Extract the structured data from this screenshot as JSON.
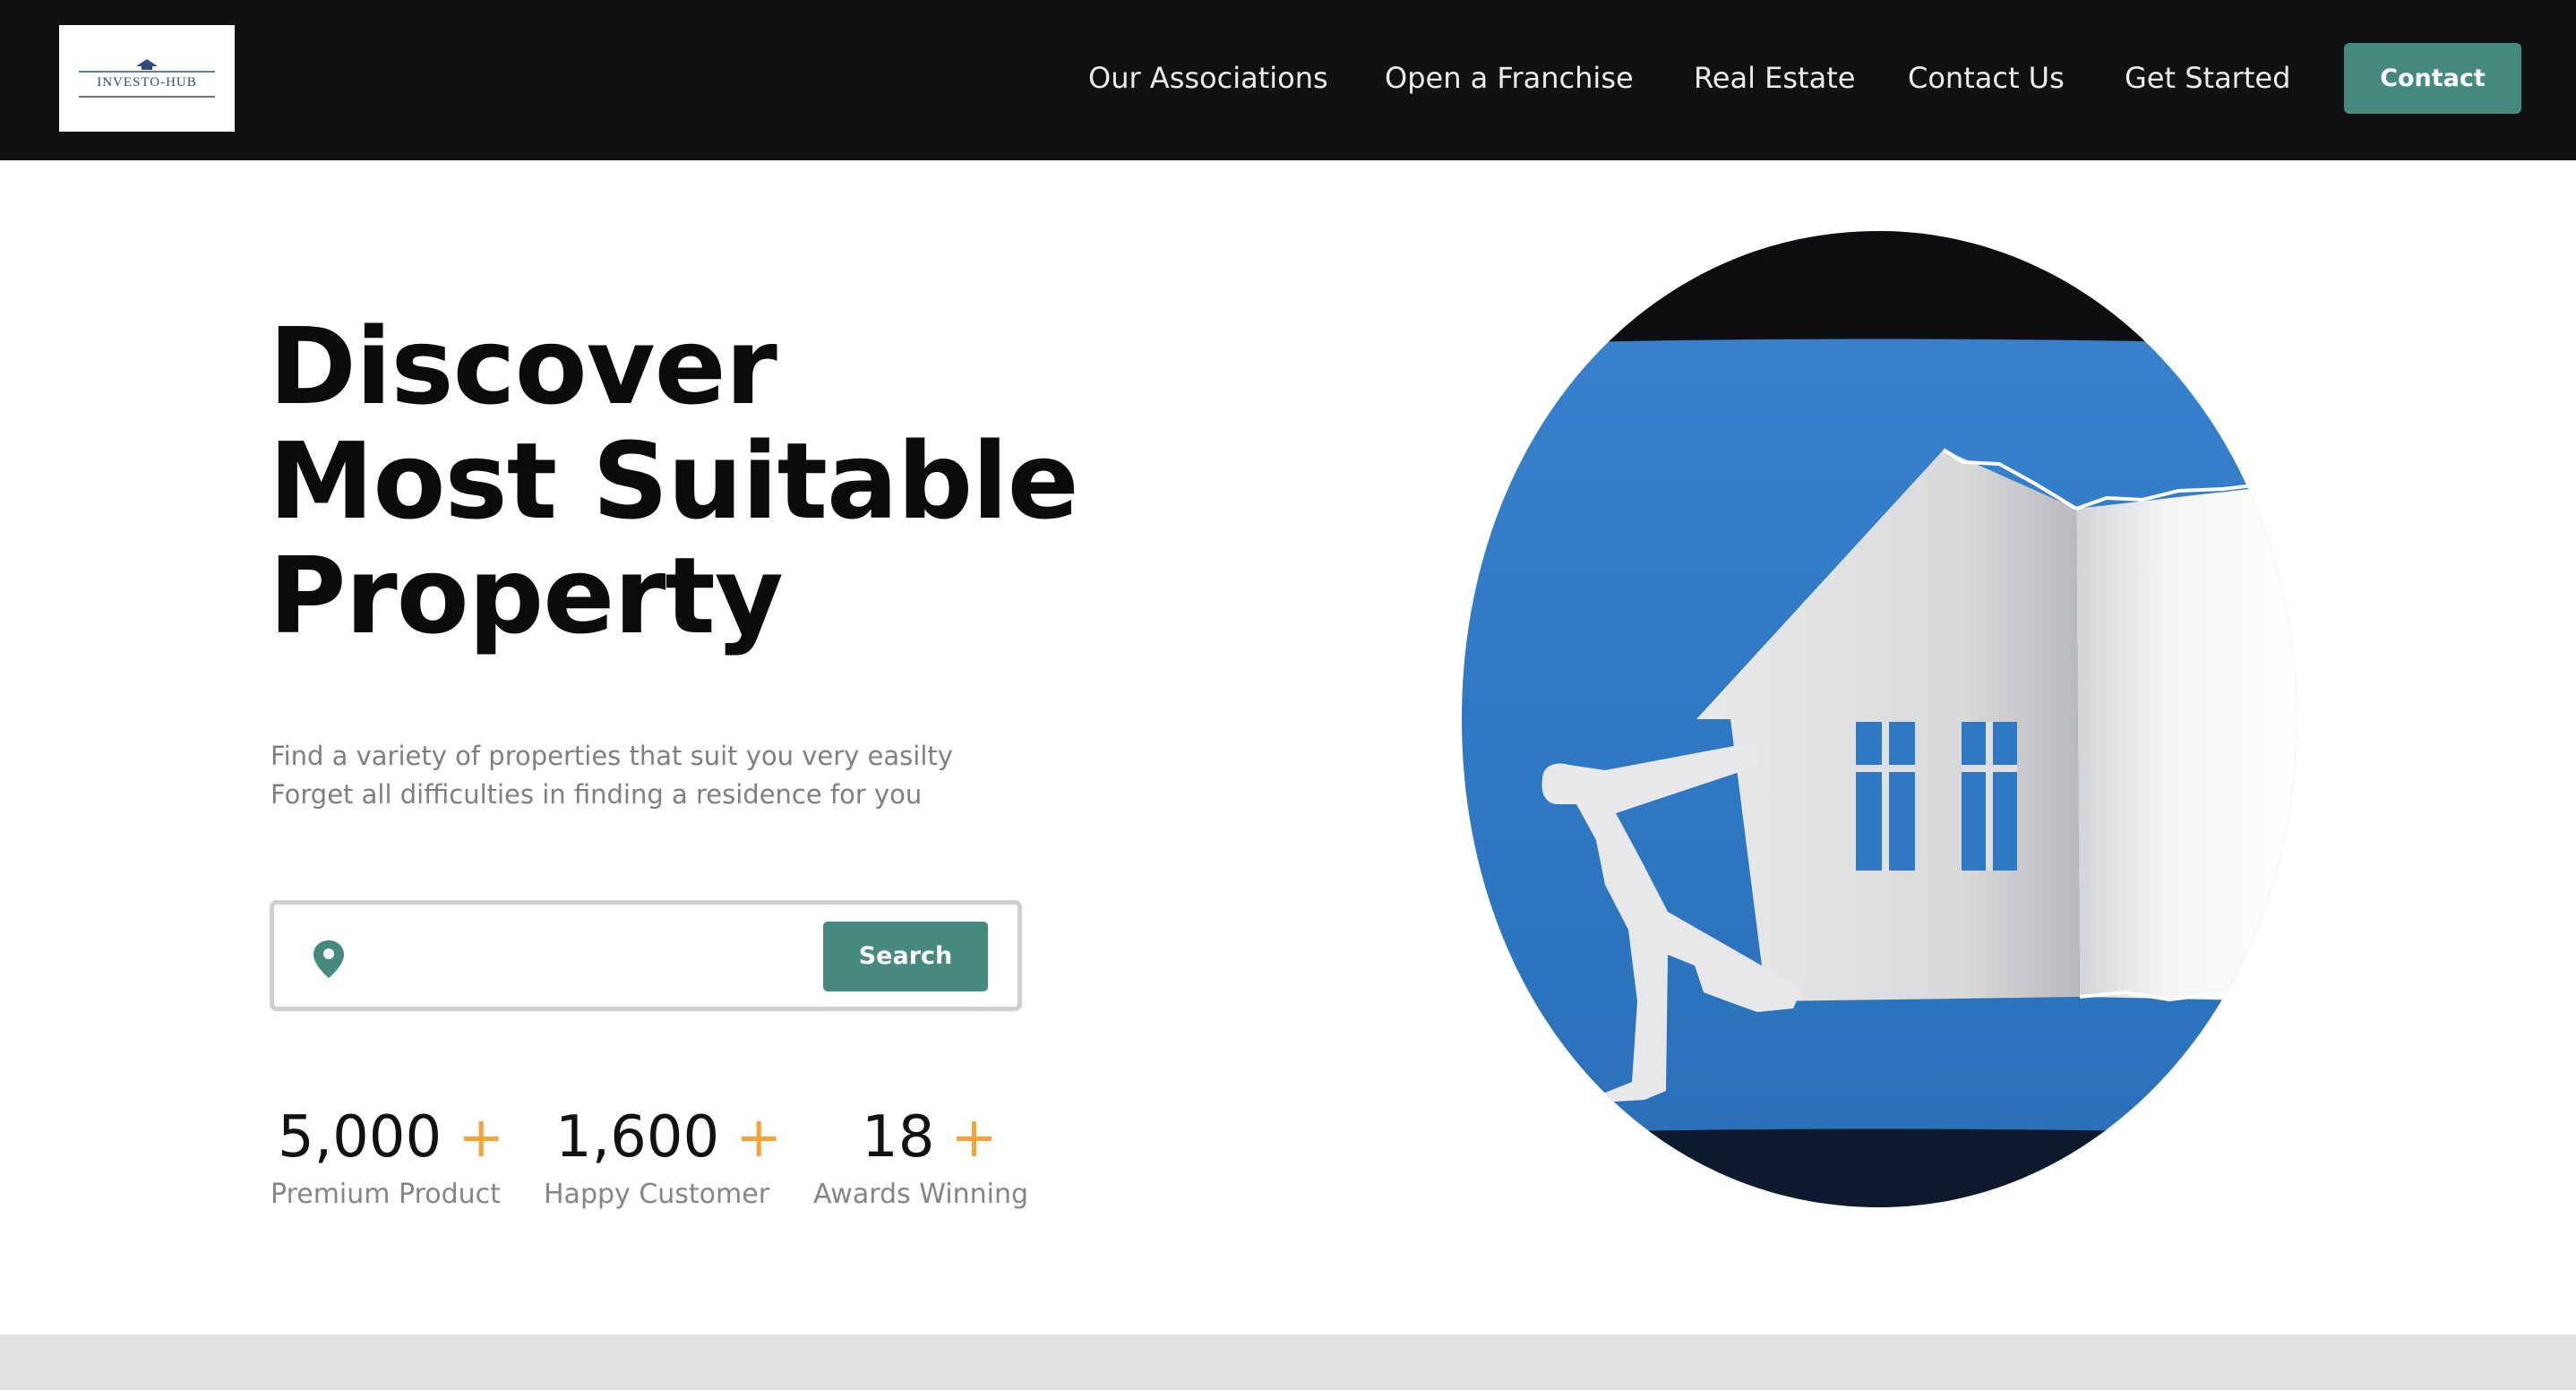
{
  "brand": {
    "logo_text": "INVESTO-HUB",
    "logo_color": "#2f4c7a"
  },
  "nav": {
    "items": [
      {
        "label": "Our Associations"
      },
      {
        "label": "Open a Franchise"
      },
      {
        "label": "Real Estate"
      },
      {
        "label": "Contact Us"
      },
      {
        "label": "Get Started"
      }
    ],
    "contact_label": "Contact"
  },
  "hero": {
    "headline": [
      "Discover",
      "Most Suitable",
      "Property"
    ],
    "subtext": [
      "Find a variety of properties that suit you very easilty",
      "Forget all difficulties in finding a residence for you"
    ],
    "search": {
      "value": "",
      "placeholder": "",
      "button_label": "Search",
      "icon": "location-pin-icon"
    },
    "stats": [
      {
        "number": "5,000",
        "plus": "+",
        "label": "Premium Product"
      },
      {
        "number": "1,600",
        "plus": "+",
        "label": "Happy Customer"
      },
      {
        "number": "18",
        "plus": "+",
        "label": "Awards Winning"
      }
    ],
    "illustration": "house-puller-illustration"
  },
  "colors": {
    "header_bg": "#121111",
    "accent_teal": "#468a7f",
    "accent_orange": "#f0a43a",
    "headline": "#0b0b0b",
    "muted_text": "#7f7f7f",
    "illustration_blue": "#2f79c4"
  }
}
